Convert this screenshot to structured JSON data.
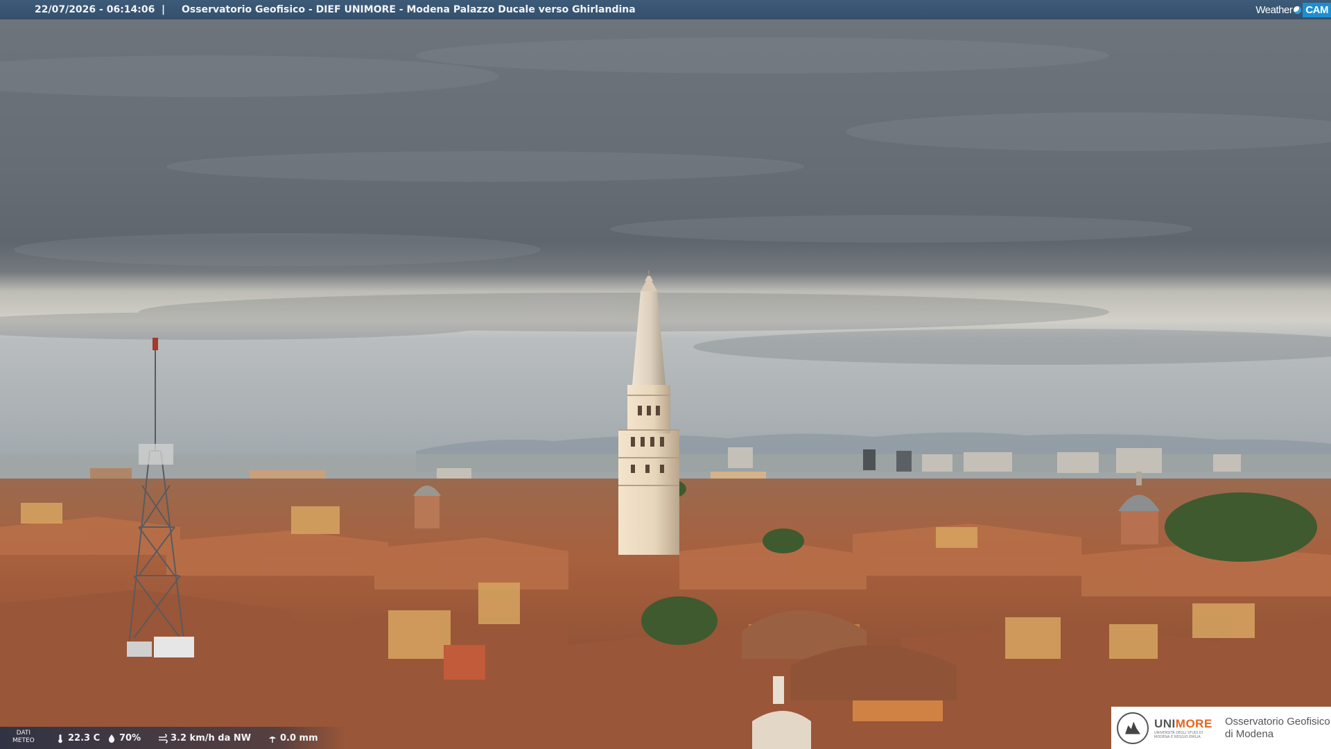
{
  "header": {
    "timestamp": "22/07/2026 - 06:14:06",
    "separator": "|",
    "caption": "Osservatorio Geofisico - DIEF UNIMORE - Modena Palazzo Ducale verso Ghirlandina"
  },
  "logo": {
    "weather_text": "Weather",
    "cam_text": "CAM"
  },
  "weather": {
    "label_line1": "DATI",
    "label_line2": "METEO",
    "temperature": "22.3 C",
    "humidity": "70%",
    "wind": "3.2 km/h da NW",
    "rain": "0.0 mm",
    "icons": [
      "thermometer-icon",
      "humidity-drop-icon",
      "wind-icon",
      "rain-gauge-icon"
    ]
  },
  "unimore": {
    "uni": "UNI",
    "more": "MORE",
    "subtitle": "UNIVERSITÀ DEGLI STUDI DI MODENA E REGGIO EMILIA",
    "observatory_line1": "Osservatorio Geofisico",
    "observatory_line2": "di Modena"
  },
  "colors": {
    "sky_top": "#6d747b",
    "sky_band": "#c9c8c1",
    "roofs": "#b06a45",
    "tower_lit": "#eddcc2",
    "bar_blue": "#34506d",
    "cam_blue": "#1e8ed0",
    "unimore_orange": "#e8631c"
  }
}
